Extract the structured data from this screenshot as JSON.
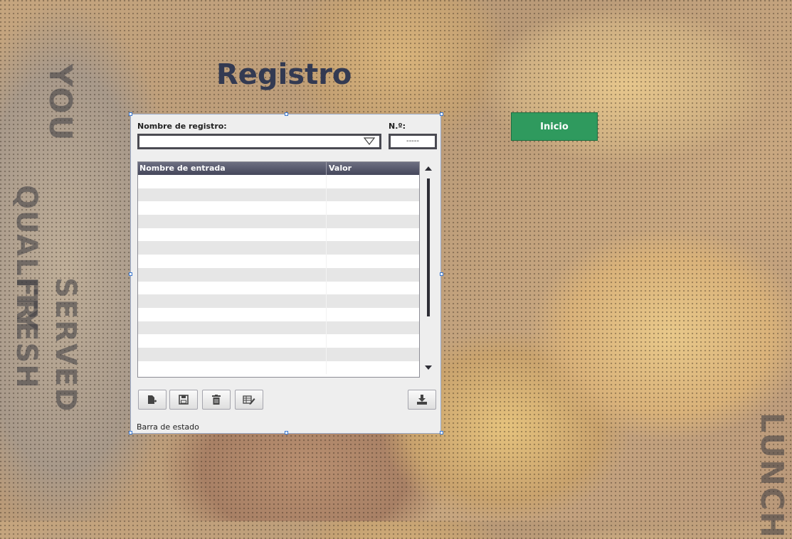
{
  "page": {
    "title": "Registro",
    "start_button": "Inicio"
  },
  "background_text": [
    "QUALITY",
    "YOU",
    "FRESH",
    "SERVED",
    "LUNCH"
  ],
  "panel": {
    "registry_name_label": "Nombre de registro:",
    "number_label": "N.º:",
    "number_value": "-----",
    "columns": [
      "Nombre de entrada",
      "Valor"
    ],
    "rows": [
      [
        "",
        ""
      ],
      [
        "",
        ""
      ],
      [
        "",
        ""
      ],
      [
        "",
        ""
      ],
      [
        "",
        ""
      ],
      [
        "",
        ""
      ],
      [
        "",
        ""
      ],
      [
        "",
        ""
      ],
      [
        "",
        ""
      ],
      [
        "",
        ""
      ],
      [
        "",
        ""
      ],
      [
        "",
        ""
      ],
      [
        "",
        ""
      ],
      [
        "",
        ""
      ],
      [
        "",
        ""
      ]
    ],
    "toolbar": {
      "new_icon": "new-entry-icon",
      "save_icon": "save-icon",
      "delete_icon": "trash-icon",
      "edit_icon": "edit-table-icon",
      "export_icon": "download-icon"
    },
    "status_text": "Barra de estado"
  },
  "colors": {
    "title": "#333a52",
    "start_button": "#2f9a5e",
    "grid_header": "#44465a",
    "selection_handle": "#3a78d0"
  }
}
